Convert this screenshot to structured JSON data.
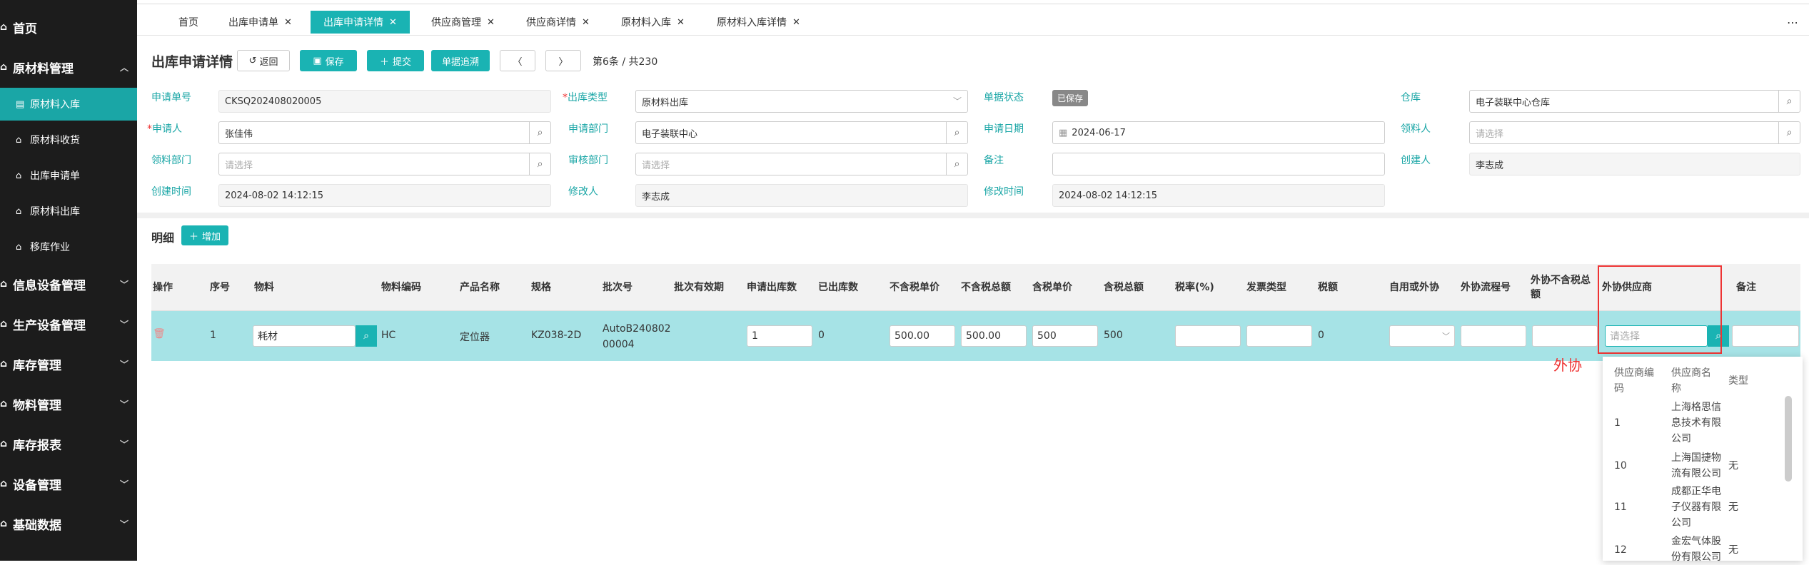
{
  "sidebar": {
    "items": [
      {
        "label": "首页",
        "icon": "home-icon"
      },
      {
        "label": "原材料管理",
        "icon": "home-icon"
      },
      {
        "label": "信息设备管理",
        "icon": "home-icon"
      },
      {
        "label": "生产设备管理",
        "icon": "home-icon"
      },
      {
        "label": "库存管理",
        "icon": "home-icon"
      },
      {
        "label": "物料管理",
        "icon": "home-icon"
      },
      {
        "label": "库存报表",
        "icon": "home-icon"
      },
      {
        "label": "设备管理",
        "icon": "home-icon"
      },
      {
        "label": "基础数据",
        "icon": "home-icon"
      }
    ],
    "subitems": [
      "原材料入库",
      "原材料收货",
      "出库申请单",
      "原材料出库",
      "移库作业"
    ]
  },
  "tabs": [
    {
      "label": "首页",
      "closable": false
    },
    {
      "label": "出库申请单",
      "closable": true
    },
    {
      "label": "出库申请详情",
      "closable": true,
      "active": true
    },
    {
      "label": "供应商管理",
      "closable": true
    },
    {
      "label": "供应商详情",
      "closable": true
    },
    {
      "label": "原材料入库",
      "closable": true
    },
    {
      "label": "原材料入库详情",
      "closable": true
    }
  ],
  "page": {
    "title": "出库申请详情",
    "buttons": {
      "back": "返回",
      "save": "保存",
      "submit": "提交",
      "trace": "单据追溯"
    },
    "pager": "第6条 / 共230"
  },
  "form": {
    "labels": {
      "apply_no": "申请单号",
      "out_type": "出库类型",
      "status": "单据状态",
      "warehouse": "仓库",
      "applicant": "申请人",
      "apply_dept": "申请部门",
      "apply_date": "申请日期",
      "receiver": "领料人",
      "recv_dept": "领料部门",
      "audit_dept": "审核部门",
      "remark": "备注",
      "creator": "创建人",
      "create_time": "创建时间",
      "modifier": "修改人",
      "modify_time": "修改时间"
    },
    "values": {
      "apply_no": "CKSQ202408020005",
      "out_type": "原材料出库",
      "status": "已保存",
      "warehouse": "电子装联中心仓库",
      "applicant": "张佳伟",
      "apply_dept": "电子装联中心",
      "apply_date": "2024-06-17",
      "creator": "李志成",
      "create_time": "2024-08-02 14:12:15",
      "modifier": "李志成",
      "modify_time": "2024-08-02 14:12:15"
    },
    "placeholder": "请选择"
  },
  "detail": {
    "title": "明细",
    "add_label": "增加",
    "headers": [
      "操作",
      "序号",
      "物料",
      "物料编码",
      "产品名称",
      "规格",
      "批次号",
      "批次有效期",
      "申请出库数",
      "已出库数",
      "不含税单价",
      "不含税总额",
      "含税单价",
      "含税总额",
      "税率(%)",
      "发票类型",
      "税额",
      "自用或外协",
      "外协流程号",
      "外协不含税总额",
      "外协供应商",
      "备注"
    ],
    "row": {
      "index": "1",
      "material": "耗材",
      "code": "HC",
      "product": "定位器",
      "spec": "KZ038-2D",
      "batch": "AutoB24080200004",
      "apply_qty": "1",
      "out_qty": "0",
      "price": "500.00",
      "total": "500.00",
      "tax_price": "500",
      "tax_total": "500",
      "tax_amount": "0",
      "supplier_placeholder": "请选择"
    }
  },
  "annotation": "外协",
  "supplier_popup": {
    "headers": [
      "供应商编码",
      "供应商名称",
      "类型"
    ],
    "rows": [
      {
        "code": "1",
        "name": "上海格思信息技术有限公司",
        "type": ""
      },
      {
        "code": "10",
        "name": "上海国捷物流有限公司",
        "type": "无"
      },
      {
        "code": "11",
        "name": "成都正华电子仪器有限公司",
        "type": "无"
      },
      {
        "code": "12",
        "name": "金宏气体股份有限公司",
        "type": "无"
      }
    ]
  },
  "colors": {
    "accent": "#1ab3b3",
    "sidebar_bg": "#1c1c1c",
    "row_highlight": "#a6e3e6",
    "annotation": "#e33333"
  }
}
